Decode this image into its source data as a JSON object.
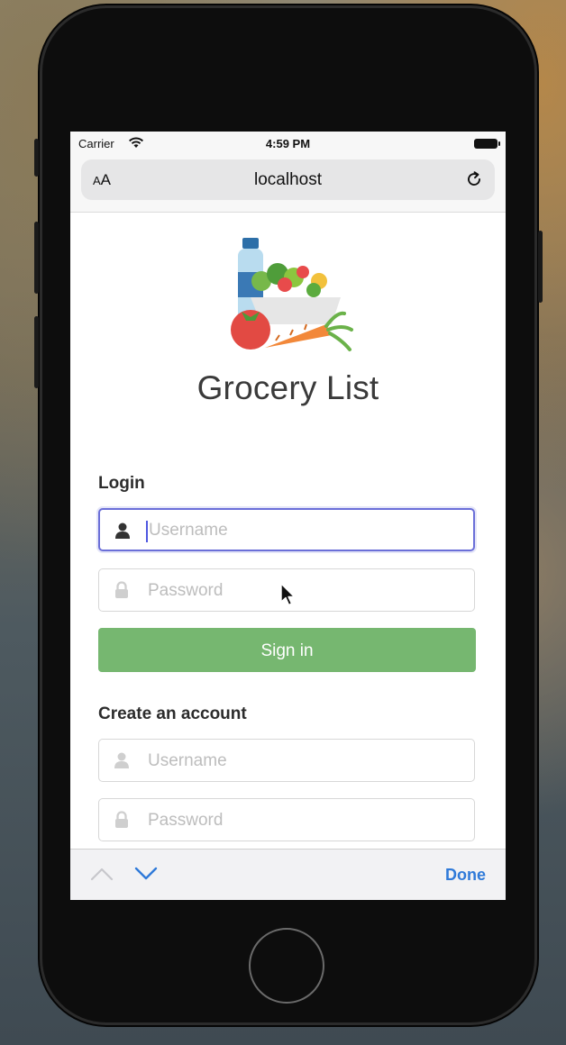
{
  "status_bar": {
    "carrier": "Carrier",
    "time": "4:59 PM"
  },
  "browser": {
    "text_size_small": "A",
    "text_size_large": "A",
    "host": "localhost"
  },
  "app": {
    "title": "Grocery List"
  },
  "login": {
    "label": "Login",
    "username_placeholder": "Username",
    "password_placeholder": "Password",
    "signin_label": "Sign in"
  },
  "create": {
    "label": "Create an account",
    "username_placeholder": "Username",
    "password_placeholder": "Password"
  },
  "keyboard_toolbar": {
    "done_label": "Done"
  },
  "colors": {
    "accent_focus": "#6b6fd8",
    "signin_button": "#76b770",
    "done_link": "#2f7ad9"
  },
  "icons": [
    "wifi-icon",
    "battery-icon",
    "reload-icon",
    "grocery-logo",
    "user-icon",
    "lock-icon",
    "chevron-up-icon",
    "chevron-down-icon",
    "mouse-cursor",
    "home-button"
  ]
}
